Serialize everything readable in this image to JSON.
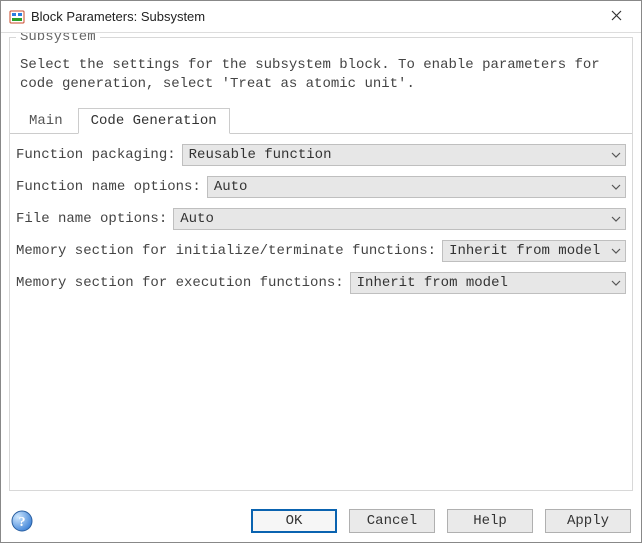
{
  "window": {
    "title": "Block Parameters: Subsystem"
  },
  "group": {
    "label": "Subsystem",
    "description": "Select the settings for the subsystem block. To enable parameters for code generation, select 'Treat as atomic unit'."
  },
  "tabs": {
    "main": "Main",
    "codegen": "Code Generation",
    "active": "codegen"
  },
  "fields": {
    "function_packaging": {
      "label": "Function packaging:",
      "value": "Reusable function"
    },
    "function_name_options": {
      "label": "Function name options:",
      "value": "Auto"
    },
    "file_name_options": {
      "label": "File name options:",
      "value": "Auto"
    },
    "mem_init_term": {
      "label": "Memory section for initialize/terminate functions:",
      "value": "Inherit from model"
    },
    "mem_exec": {
      "label": "Memory section for execution functions:",
      "value": "Inherit from model"
    }
  },
  "buttons": {
    "ok": "OK",
    "cancel": "Cancel",
    "help": "Help",
    "apply": "Apply"
  }
}
